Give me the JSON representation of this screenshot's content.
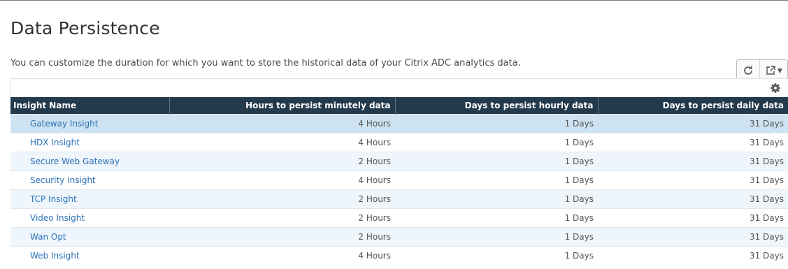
{
  "page": {
    "title": "Data Persistence",
    "description": "You can customize the duration for which you want to store the historical data of your Citrix ADC analytics data."
  },
  "toolbar": {
    "refresh_icon": "refresh-icon",
    "export_icon": "export-icon"
  },
  "table": {
    "columns": [
      "Insight Name",
      "Hours to persist minutely data",
      "Days to persist hourly data",
      "Days to persist daily data"
    ],
    "rows": [
      {
        "name": "Gateway Insight",
        "minutely": "4 Hours",
        "hourly": "1 Days",
        "daily": "31 Days",
        "selected": true
      },
      {
        "name": "HDX Insight",
        "minutely": "4 Hours",
        "hourly": "1 Days",
        "daily": "31 Days"
      },
      {
        "name": "Secure Web Gateway",
        "minutely": "2 Hours",
        "hourly": "1 Days",
        "daily": "31 Days"
      },
      {
        "name": "Security Insight",
        "minutely": "4 Hours",
        "hourly": "1 Days",
        "daily": "31 Days"
      },
      {
        "name": "TCP Insight",
        "minutely": "2 Hours",
        "hourly": "1 Days",
        "daily": "31 Days"
      },
      {
        "name": "Video Insight",
        "minutely": "2 Hours",
        "hourly": "1 Days",
        "daily": "31 Days"
      },
      {
        "name": "Wan Opt",
        "minutely": "2 Hours",
        "hourly": "1 Days",
        "daily": "31 Days"
      },
      {
        "name": "Web Insight",
        "minutely": "4 Hours",
        "hourly": "1 Days",
        "daily": "31 Days"
      }
    ]
  },
  "colors": {
    "header_bg": "#23394c",
    "link": "#2a73b8",
    "selected_row": "#cde3f1",
    "zebra_row": "#eef5fb"
  }
}
